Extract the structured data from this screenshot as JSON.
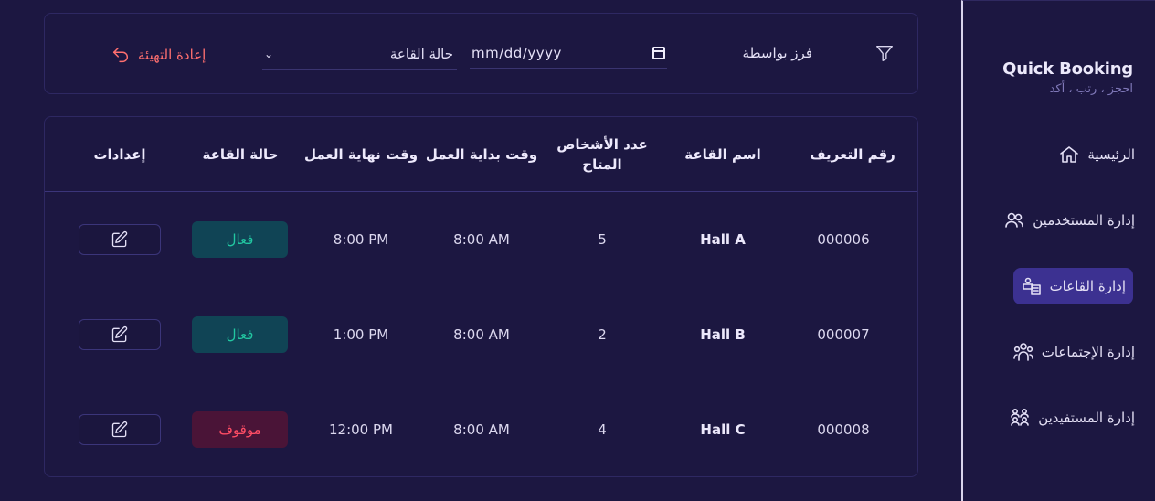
{
  "brand": {
    "title": "Quick Booking",
    "subtitle": "احجز ، رتب ، أكد"
  },
  "sidebar": {
    "items": [
      {
        "label": "الرئيسية",
        "icon": "home-icon",
        "active": false
      },
      {
        "label": "إدارة المستخدمين",
        "icon": "users-icon",
        "active": false
      },
      {
        "label": "إدارة القاعات",
        "icon": "halls-icon",
        "active": true
      },
      {
        "label": "إدارة الإجتماعات",
        "icon": "meetings-icon",
        "active": false
      },
      {
        "label": "إدارة المستفيدين",
        "icon": "beneficiaries-icon",
        "active": false
      }
    ]
  },
  "filters": {
    "icon": "filter-icon",
    "sort_label": "فرز بواسطة",
    "date_placeholder": "mm/dd/yyyy",
    "status_placeholder": "حالة القاعة",
    "reset_label": "إعادة التهيئة",
    "reset_icon": "undo-icon"
  },
  "table": {
    "headers": {
      "id": "رقم التعريف",
      "name": "اسم القاعة",
      "capacity_line1": "عدد الأشخاص",
      "capacity_line2": "المتاح",
      "start": "وقت بداية العمل",
      "end": "وقت نهاية العمل",
      "status": "حالة القاعة",
      "settings": "إعدادات"
    },
    "rows": [
      {
        "id": "000006",
        "name": "Hall A",
        "capacity": "5",
        "start": "8:00 AM",
        "end": "8:00 PM",
        "status": "فعال",
        "status_type": "active"
      },
      {
        "id": "000007",
        "name": "Hall B",
        "capacity": "2",
        "start": "8:00 AM",
        "end": "1:00 PM",
        "status": "فعال",
        "status_type": "active"
      },
      {
        "id": "000008",
        "name": "Hall C",
        "capacity": "4",
        "start": "8:00 AM",
        "end": "12:00 PM",
        "status": "موقوف",
        "status_type": "stopped"
      }
    ]
  },
  "colors": {
    "background": "#1c1741",
    "active_nav": "#3c3191",
    "status_active_bg": "#104455",
    "status_active_text": "#22c7a1",
    "status_stopped_bg": "#4a1437",
    "status_stopped_text": "#ff4d65",
    "reset_text": "#ff6f6f"
  }
}
